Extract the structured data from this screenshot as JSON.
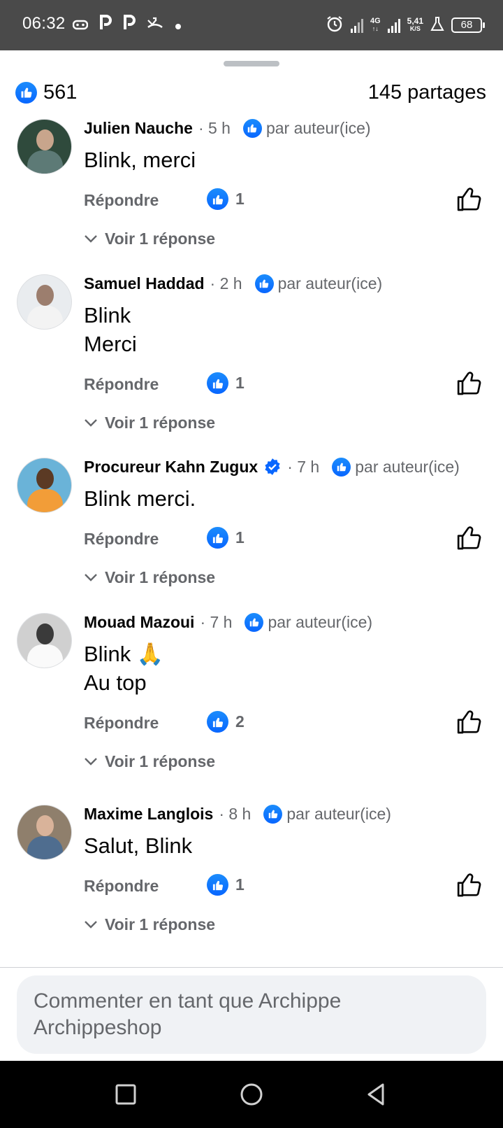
{
  "status_bar": {
    "time": "06:32",
    "left_icons": [
      "gamepad-icon",
      "p-icon",
      "p-icon",
      "missed-call-icon",
      "dot-icon"
    ],
    "net_4g": "4G",
    "speed_value": "5,41",
    "speed_unit": "K/S",
    "battery": "68"
  },
  "summary": {
    "likes": "561",
    "shares": "145 partages"
  },
  "labels": {
    "reply": "Répondre",
    "view_replies": "Voir 1 réponse",
    "liked_by_author": "par auteur(ice)"
  },
  "comments": [
    {
      "name": "Julien Nauche",
      "time": "· 5 h",
      "text": "Blink, merci",
      "likes": "1",
      "verified": false,
      "avatar_colors": [
        "#2f4a3c",
        "#c8a58c",
        "#5d7a76"
      ]
    },
    {
      "name": "Samuel Haddad",
      "time": "· 2 h",
      "text": "Blink\nMerci",
      "likes": "1",
      "verified": false,
      "avatar_colors": [
        "#e9ecef",
        "#9c7e6e",
        "#f3f3f3"
      ]
    },
    {
      "name": "Procureur Kahn Zugux",
      "time": "· 7 h",
      "text": "Blink merci.",
      "likes": "1",
      "verified": true,
      "avatar_colors": [
        "#6ab3d8",
        "#5b3a24",
        "#f29d38"
      ]
    },
    {
      "name": "Mouad Mazoui",
      "time": "· 7 h",
      "text": "Blink 🙏\nAu top",
      "likes": "2",
      "verified": false,
      "avatar_colors": [
        "#d0d0d0",
        "#3a3a3a",
        "#fafafa"
      ]
    },
    {
      "name": "Maxime Langlois",
      "time": "· 8 h",
      "text": "Salut, Blink",
      "likes": "1",
      "verified": false,
      "avatar_colors": [
        "#8f7f6c",
        "#d9b39a",
        "#4f6d8f"
      ]
    }
  ],
  "composer": {
    "placeholder": "Commenter en tant que Archippe Archippeshop"
  },
  "colors": {
    "brand_blue": "#0866ff",
    "secondary_text": "#65676b",
    "status_bar_bg": "#4a4a4a"
  }
}
